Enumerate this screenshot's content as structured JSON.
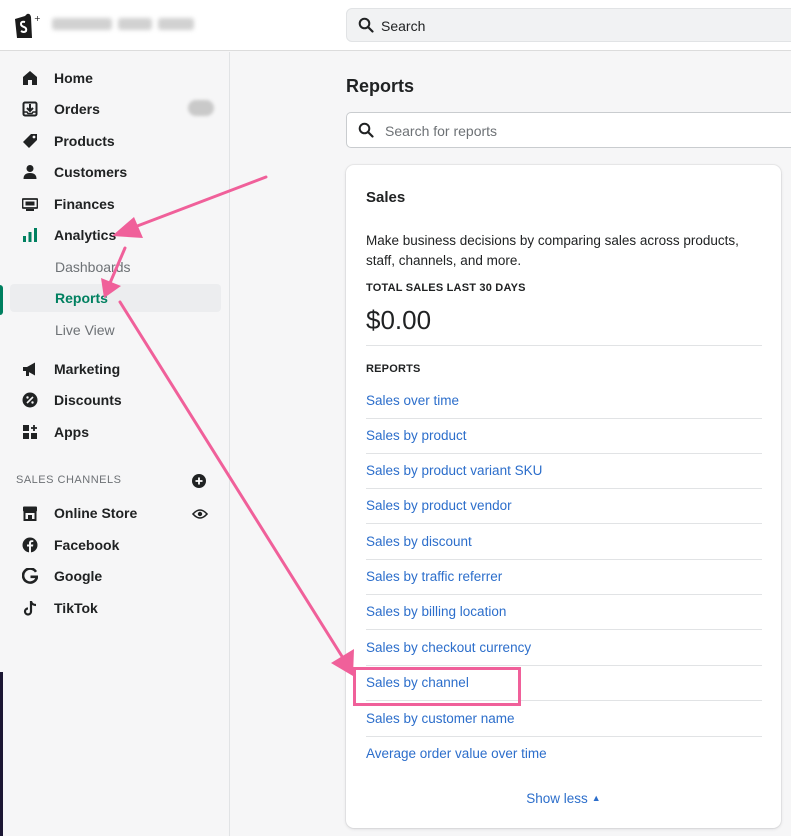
{
  "topbar": {
    "search_placeholder": "Search"
  },
  "sidebar": {
    "items": [
      {
        "label": "Home",
        "icon": "home-icon"
      },
      {
        "label": "Orders",
        "icon": "orders-icon"
      },
      {
        "label": "Products",
        "icon": "tag-icon"
      },
      {
        "label": "Customers",
        "icon": "person-icon"
      },
      {
        "label": "Finances",
        "icon": "finances-icon"
      },
      {
        "label": "Analytics",
        "icon": "bar-chart-icon"
      }
    ],
    "analytics_sub": [
      {
        "label": "Dashboards"
      },
      {
        "label": "Reports",
        "active": true
      },
      {
        "label": "Live View"
      }
    ],
    "more_items": [
      {
        "label": "Marketing",
        "icon": "megaphone-icon"
      },
      {
        "label": "Discounts",
        "icon": "discount-icon"
      },
      {
        "label": "Apps",
        "icon": "apps-icon"
      }
    ],
    "sales_channels_heading": "SALES CHANNELS",
    "channels": [
      {
        "label": "Online Store",
        "icon": "store-icon"
      },
      {
        "label": "Facebook",
        "icon": "facebook-icon"
      },
      {
        "label": "Google",
        "icon": "google-icon"
      },
      {
        "label": "TikTok",
        "icon": "tiktok-icon"
      }
    ]
  },
  "main": {
    "title": "Reports",
    "search_placeholder": "Search for reports",
    "card": {
      "title": "Sales",
      "description": "Make business decisions by comparing sales across products, staff, channels, and more.",
      "total_label": "TOTAL SALES LAST 30 DAYS",
      "total_value": "$0.00",
      "reports_label": "REPORTS",
      "reports": [
        "Sales over time",
        "Sales by product",
        "Sales by product variant SKU",
        "Sales by product vendor",
        "Sales by discount",
        "Sales by traffic referrer",
        "Sales by billing location",
        "Sales by checkout currency",
        "Sales by channel",
        "Sales by customer name",
        "Average order value over time"
      ],
      "show_less": "Show less"
    }
  },
  "colors": {
    "accent_green": "#008060",
    "link_blue": "#2c6ecb",
    "annotation_pink": "#f0609a"
  }
}
